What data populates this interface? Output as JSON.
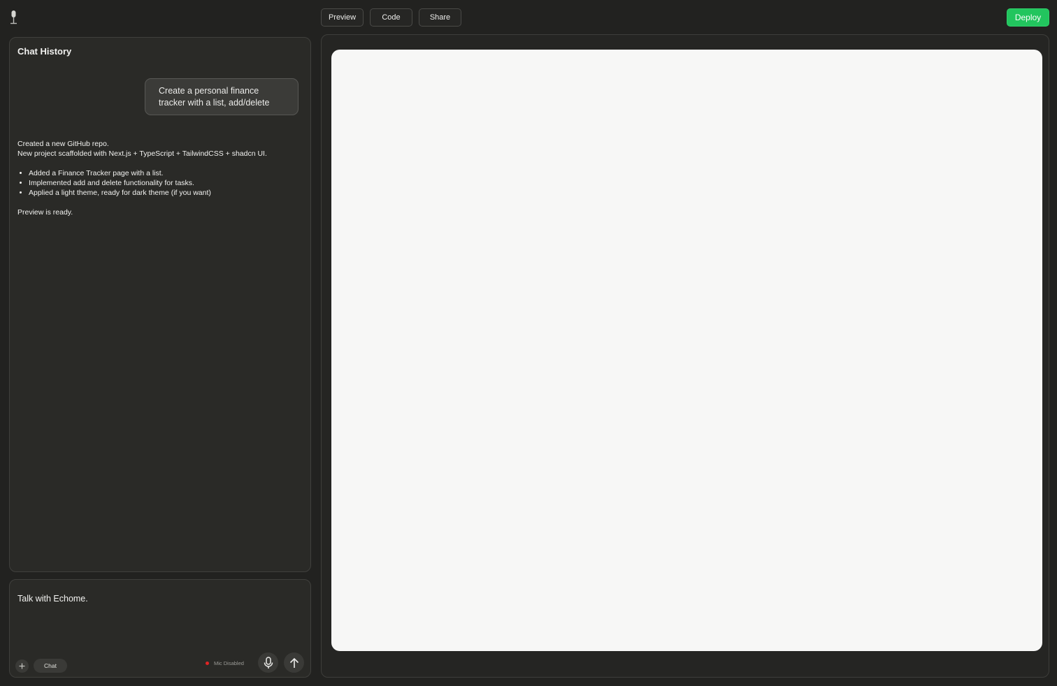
{
  "header": {
    "logo_icon": "microphone-icon",
    "tabs": [
      {
        "label": "Preview"
      },
      {
        "label": "Code"
      },
      {
        "label": "Share"
      }
    ],
    "deploy_label": "Deploy",
    "deploy_color": "#22c55e"
  },
  "chat": {
    "title": "Chat History",
    "user_message": "Create a personal finance tracker with a list, add/delete",
    "assistant": {
      "line1": "Created a new GitHub repo.",
      "line2": "New project scaffolded with Next.js + TypeScript + TailwindCSS + shadcn UI.",
      "bullets": [
        "Added a Finance Tracker page with a list.",
        "Implemented add and delete functionality for tasks.",
        "Applied a light theme, ready for dark theme (if you want)"
      ],
      "footer": "Preview is ready."
    }
  },
  "input": {
    "placeholder": "Talk with Echome.",
    "plus_icon": "plus-icon",
    "mode_label": "Chat",
    "mic_status": "Mic Disabled",
    "mic_status_color": "#e02424",
    "mic_icon": "microphone-icon",
    "send_icon": "arrow-up-icon"
  }
}
